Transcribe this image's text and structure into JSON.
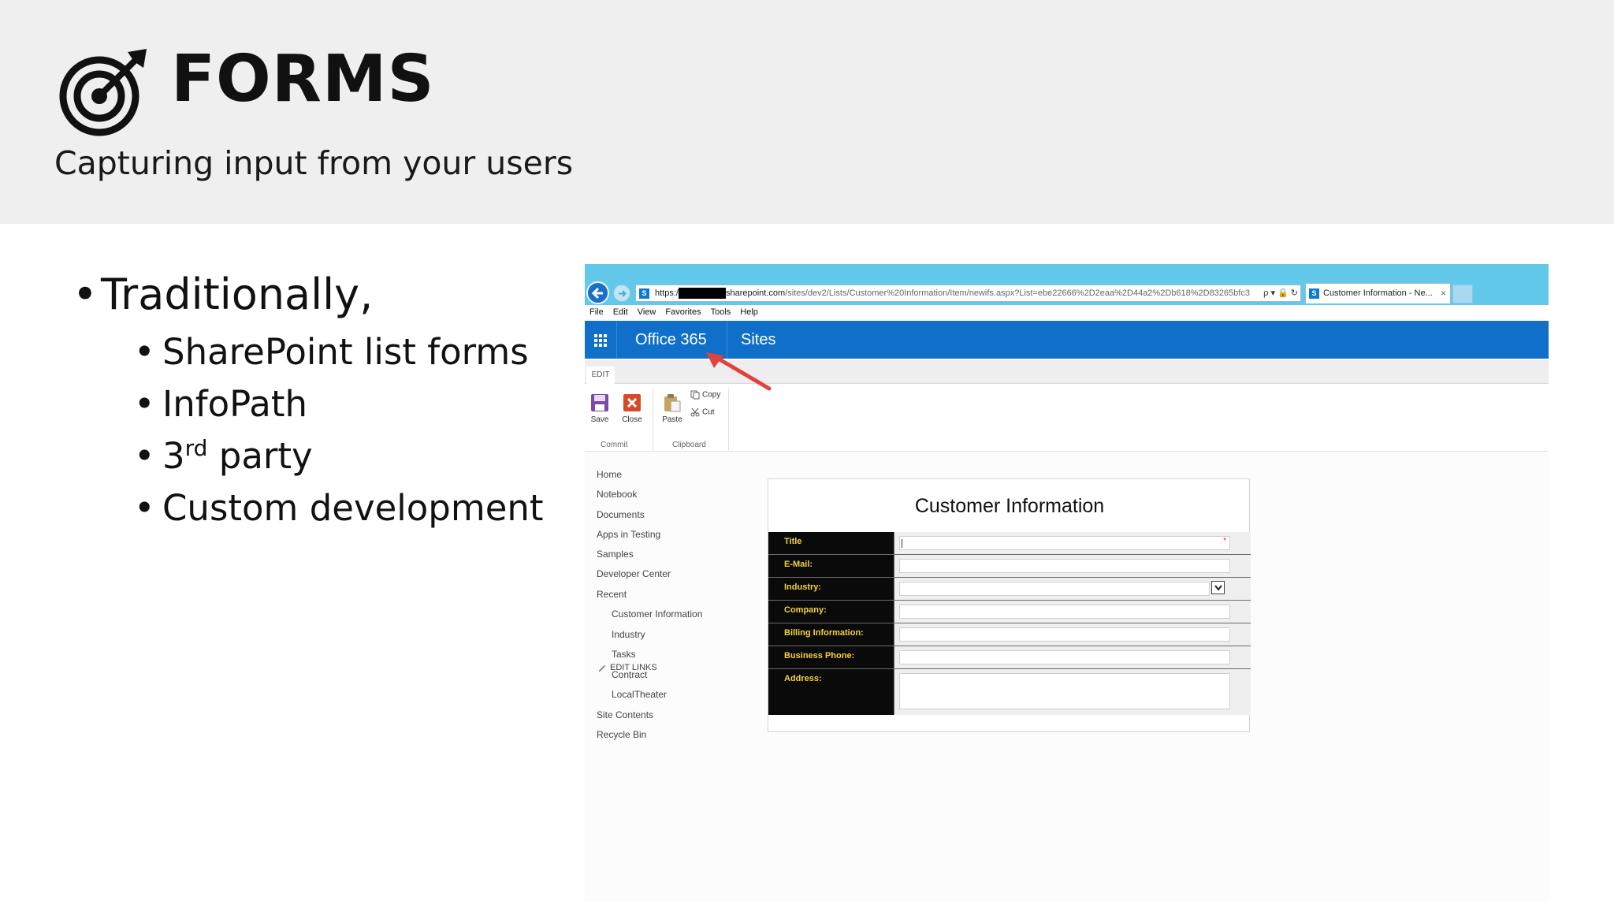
{
  "header": {
    "title": "FORMS",
    "subtitle": "Capturing input from your users"
  },
  "bullets": {
    "main": "Traditionally,",
    "sub": [
      "SharePoint list forms",
      "InfoPath",
      "3",
      "party",
      "Custom development"
    ],
    "superscript": "rd"
  },
  "browser": {
    "url_prefix": "https:/",
    "url_domain": "sharepoint.com",
    "url_path": "/sites/dev2/Lists/Customer%20Information/Item/newifs.aspx?List=ebe22666%2D2eaa%2D44a2%2Db618%2D83265bfc3",
    "url_tools": "ρ ▾ 🔒 ↻",
    "tab_title": "Customer Information - Ne...",
    "tab_close": "×",
    "menu": [
      "File",
      "Edit",
      "View",
      "Favorites",
      "Tools",
      "Help"
    ]
  },
  "suite_bar": {
    "brand": "Office 365",
    "sites": "Sites"
  },
  "ribbon": {
    "tab": "EDIT",
    "save": "Save",
    "close": "Close",
    "paste": "Paste",
    "copy": "Copy",
    "cut": "Cut",
    "group_commit": "Commit",
    "group_clipboard": "Clipboard"
  },
  "quicklaunch": {
    "items": [
      "Home",
      "Notebook",
      "Documents",
      "Apps in Testing",
      "Samples",
      "Developer Center",
      "Recent"
    ],
    "recent": [
      "Customer Information",
      "Industry",
      "Tasks",
      "Contract",
      "LocalTheater"
    ],
    "bottom": [
      "Site Contents",
      "Recycle Bin"
    ],
    "edit_links": "EDIT LINKS"
  },
  "form": {
    "title": "Customer Information",
    "fields": [
      "Title",
      "E-Mail:",
      "Industry:",
      "Company:",
      "Billing Information:",
      "Business Phone:",
      "Address:"
    ],
    "required_marker": "*"
  },
  "colors": {
    "header_bg": "#efefef",
    "browser_bar": "#62c9ea",
    "suite_bar": "#0f6fc9",
    "form_label_bg": "#0a0a0a",
    "form_label_text": "#f3d23e",
    "arrow": "#e0413a"
  }
}
